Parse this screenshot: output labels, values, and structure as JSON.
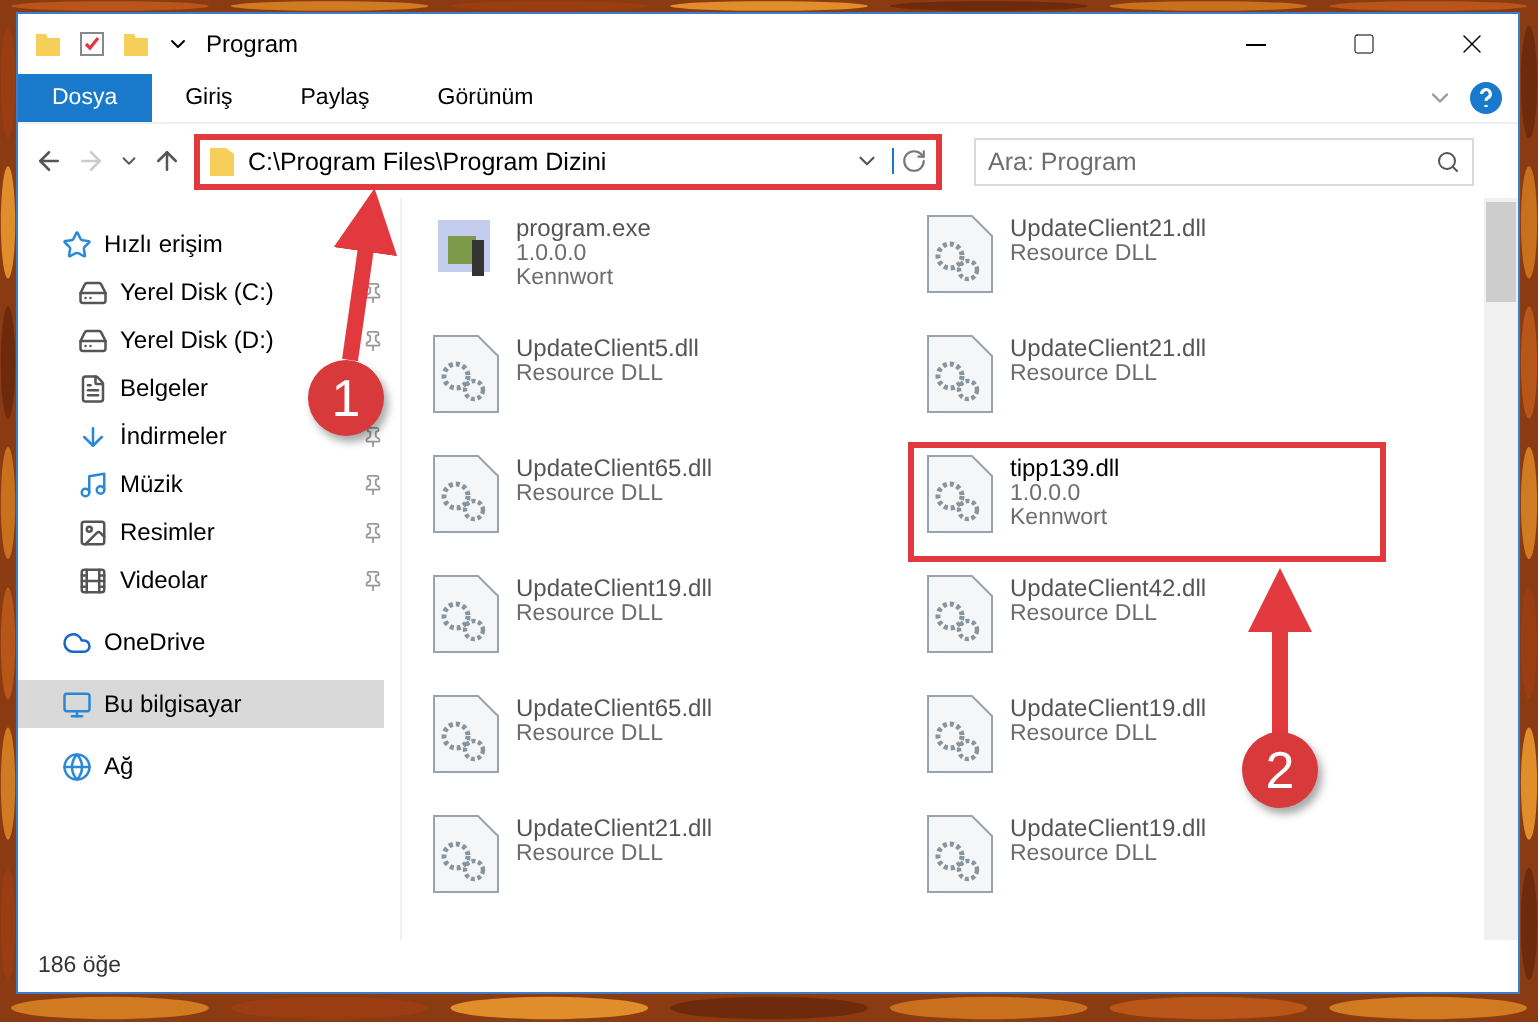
{
  "window": {
    "title": "Program"
  },
  "ribbon_tabs": [
    {
      "label": "Dosya",
      "selected": true
    },
    {
      "label": "Giriş",
      "selected": false
    },
    {
      "label": "Paylaş",
      "selected": false
    },
    {
      "label": "Görünüm",
      "selected": false
    }
  ],
  "address_bar": {
    "path": "C:\\Program Files\\Program Dizini",
    "highlighted": true
  },
  "search": {
    "placeholder": "Ara: Program"
  },
  "sidebar": {
    "items": [
      {
        "label": "Hızlı erişim",
        "pinned": false,
        "selected": false,
        "children": [
          {
            "label": "Yerel Disk (C:)",
            "pinned": true,
            "selected": false
          },
          {
            "label": "Yerel Disk (D:)",
            "pinned": true,
            "selected": false
          },
          {
            "label": "Belgeler",
            "pinned": false,
            "selected": false
          },
          {
            "label": "İndirmeler",
            "pinned": true,
            "selected": false
          },
          {
            "label": "Müzik",
            "pinned": true,
            "selected": false
          },
          {
            "label": "Resimler",
            "pinned": true,
            "selected": false
          },
          {
            "label": "Videolar",
            "pinned": true,
            "selected": false
          }
        ]
      },
      {
        "label": "OneDrive",
        "pinned": false,
        "selected": false
      },
      {
        "label": "Bu bilgisayar",
        "pinned": false,
        "selected": true
      },
      {
        "label": "Ağ",
        "pinned": false,
        "selected": false
      }
    ]
  },
  "files": [
    {
      "name": "program.exe",
      "lines": [
        "1.0.0.0",
        "Kennwort"
      ],
      "kind": "exe",
      "highlighted": false
    },
    {
      "name": "UpdateClient21.dll",
      "lines": [
        "Resource DLL"
      ],
      "kind": "dll",
      "highlighted": false
    },
    {
      "name": "UpdateClient5.dll",
      "lines": [
        "Resource DLL"
      ],
      "kind": "dll",
      "highlighted": false
    },
    {
      "name": "UpdateClient21.dll",
      "lines": [
        "Resource DLL"
      ],
      "kind": "dll",
      "highlighted": false
    },
    {
      "name": "UpdateClient65.dll",
      "lines": [
        "Resource DLL"
      ],
      "kind": "dll",
      "highlighted": false
    },
    {
      "name": "tipp139.dll",
      "lines": [
        "1.0.0.0",
        "Kennwort"
      ],
      "kind": "dll",
      "highlighted": true
    },
    {
      "name": "UpdateClient19.dll",
      "lines": [
        "Resource DLL"
      ],
      "kind": "dll",
      "highlighted": false
    },
    {
      "name": "UpdateClient42.dll",
      "lines": [
        "Resource DLL"
      ],
      "kind": "dll",
      "highlighted": false
    },
    {
      "name": "UpdateClient65.dll",
      "lines": [
        "Resource DLL"
      ],
      "kind": "dll",
      "highlighted": false
    },
    {
      "name": "UpdateClient19.dll",
      "lines": [
        "Resource DLL"
      ],
      "kind": "dll",
      "highlighted": false
    },
    {
      "name": "UpdateClient21.dll",
      "lines": [
        "Resource DLL"
      ],
      "kind": "dll",
      "highlighted": false
    },
    {
      "name": "UpdateClient19.dll",
      "lines": [
        "Resource DLL"
      ],
      "kind": "dll",
      "highlighted": false
    }
  ],
  "status_bar": {
    "count": "186 öğe"
  },
  "callouts": [
    {
      "number": "1"
    },
    {
      "number": "2"
    }
  ]
}
